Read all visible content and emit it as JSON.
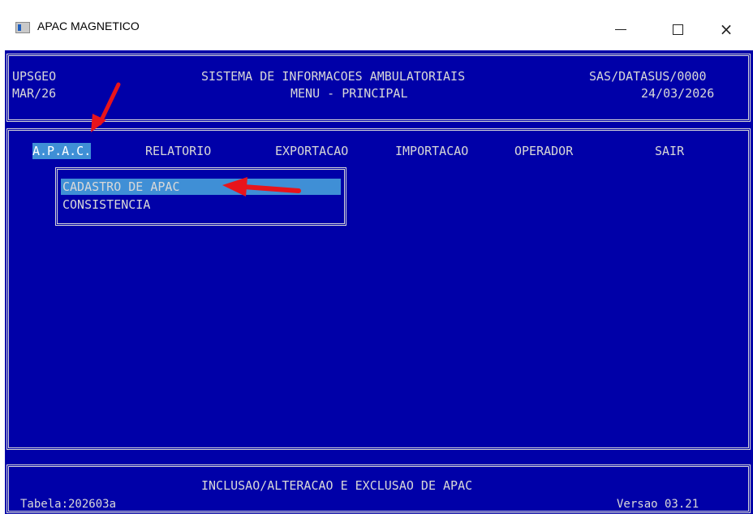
{
  "window": {
    "title": "APAC MAGNETICO",
    "minimize_glyph": "",
    "close_glyph": "×"
  },
  "header": {
    "left_line1": "UPSGEO",
    "left_line2": "MAR/26",
    "center_line1": "SISTEMA DE INFORMACOES AMBULATORIAIS",
    "center_line2": "MENU - PRINCIPAL",
    "right_line1": "SAS/DATASUS/0000",
    "right_line2": "24/03/2026"
  },
  "menu": {
    "items": [
      {
        "label": "A.P.A.C."
      },
      {
        "label": "RELATORIO"
      },
      {
        "label": "EXPORTACAO"
      },
      {
        "label": "IMPORTACAO"
      },
      {
        "label": "OPERADOR"
      },
      {
        "label": "SAIR"
      }
    ],
    "selected": "A.P.A.C."
  },
  "submenu": {
    "items": [
      {
        "label": "CADASTRO DE APAC"
      },
      {
        "label": "CONSISTENCIA"
      }
    ],
    "selected": "CADASTRO DE APAC"
  },
  "status": {
    "message": "INCLUSAO/ALTERACAO E EXCLUSAO DE APAC",
    "table_label": "Tabela:202603a",
    "version_label": "Versao 03.21"
  },
  "colors": {
    "console_bg": "#0000a8",
    "console_fg": "#d8d8d8",
    "highlight": "#3f8fd6",
    "annotation_arrow": "#e8141b"
  }
}
